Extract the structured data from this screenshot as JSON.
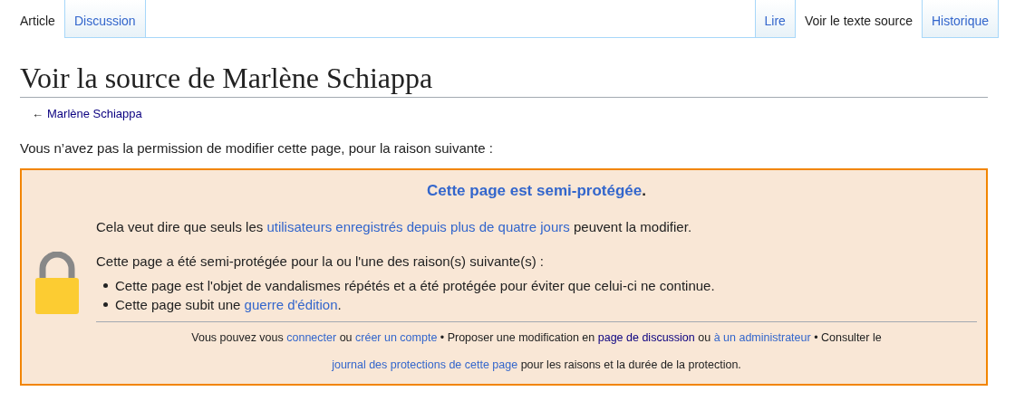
{
  "tabs_left": [
    {
      "label": "Article",
      "selected": true
    },
    {
      "label": "Discussion",
      "selected": false
    }
  ],
  "tabs_right": [
    {
      "label": "Lire",
      "selected": false
    },
    {
      "label": "Voir le texte source",
      "selected": true
    },
    {
      "label": "Historique",
      "selected": false
    }
  ],
  "title": "Voir la source de Marlène Schiappa",
  "back_link": {
    "arrow": "←",
    "label": "Marlène Schiappa"
  },
  "intro": "Vous n’avez pas la permission de modifier cette page, pour la raison suivante :",
  "notice": {
    "heading": [
      {
        "kind": "link",
        "text": "Cette page est semi-protégée"
      },
      {
        "kind": "text",
        "text": "."
      }
    ],
    "meaning": [
      {
        "kind": "text",
        "text": "Cela veut dire que seuls les "
      },
      {
        "kind": "link",
        "text": "utilisateurs enregistrés depuis plus de quatre jours"
      },
      {
        "kind": "text",
        "text": " peuvent la modifier."
      }
    ],
    "reasons_intro": [
      {
        "kind": "text",
        "text": "Cette page a été semi-protégée pour la ou l'une des raison(s) suivante(s) :"
      }
    ],
    "reasons": [
      [
        {
          "kind": "text",
          "text": "Cette page est l'objet de vandalismes répétés et a été protégée pour éviter que celui-ci ne continue."
        }
      ],
      [
        {
          "kind": "text",
          "text": "Cette page subit une "
        },
        {
          "kind": "link",
          "text": "guerre d'édition"
        },
        {
          "kind": "text",
          "text": "."
        }
      ]
    ],
    "footer": [
      {
        "kind": "text",
        "text": "Vous pouvez vous "
      },
      {
        "kind": "link",
        "text": "connecter"
      },
      {
        "kind": "text",
        "text": " ou "
      },
      {
        "kind": "link",
        "text": "créer un compte"
      },
      {
        "kind": "text",
        "text": " • Proposer une modification en "
      },
      {
        "kind": "visited",
        "text": "page de discussion"
      },
      {
        "kind": "text",
        "text": " ou "
      },
      {
        "kind": "link",
        "text": "à un administrateur"
      },
      {
        "kind": "text",
        "text": " • Consulter le "
      },
      {
        "kind": "link",
        "text": "journal des protections de cette page"
      },
      {
        "kind": "text",
        "text": " pour les raisons et la durée de la protection."
      }
    ]
  }
}
